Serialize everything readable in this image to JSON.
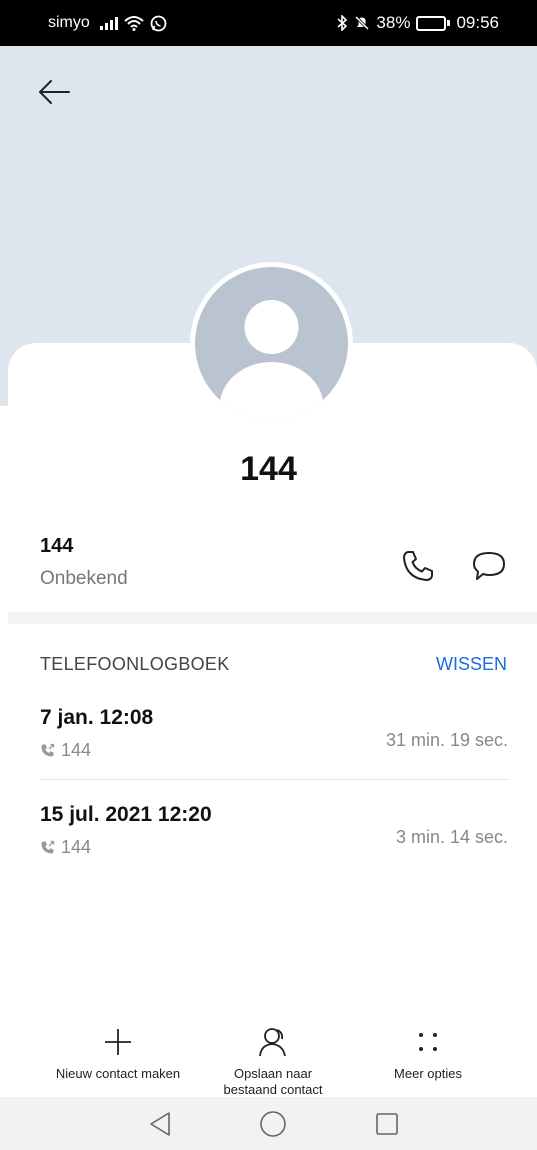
{
  "status_bar": {
    "carrier": "simyo",
    "battery": "38%",
    "battery_level": 0.38,
    "time": "09:56"
  },
  "contact": {
    "name": "144",
    "number": "144",
    "number_label": "Onbekend"
  },
  "call_log": {
    "title": "TELEFOONLOGBOEK",
    "clear_label": "WISSEN",
    "entries": [
      {
        "date": "7 jan. 12:08",
        "number": "144",
        "duration": "31 min. 19 sec."
      },
      {
        "date": "15 jul. 2021 12:20",
        "number": "144",
        "duration": "3 min. 14 sec."
      }
    ]
  },
  "actions": {
    "new_contact": "Nieuw contact maken",
    "save_existing_line1": "Opslaan naar",
    "save_existing_line2": "bestaand contact",
    "more": "Meer opties"
  },
  "icons": [
    "back-arrow-icon",
    "phone-icon",
    "message-icon",
    "plus-icon",
    "person-icon",
    "dots-icon",
    "nav-back-icon",
    "nav-home-icon",
    "nav-recent-icon"
  ]
}
